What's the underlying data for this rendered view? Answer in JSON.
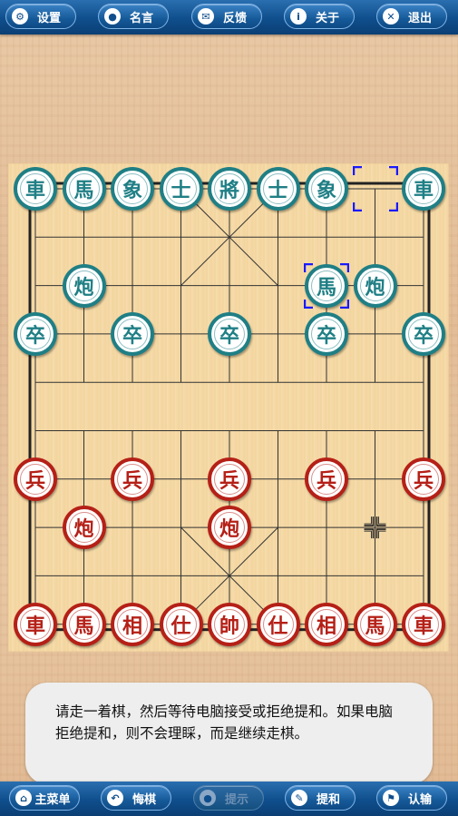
{
  "top_menu": [
    {
      "icon": "gear-icon",
      "glyph": "⚙",
      "label": "设置"
    },
    {
      "icon": "speech-bubble-icon",
      "glyph": "●",
      "label": "名言"
    },
    {
      "icon": "envelope-icon",
      "glyph": "✉",
      "label": "反馈"
    },
    {
      "icon": "info-icon",
      "glyph": "i",
      "label": "关于"
    },
    {
      "icon": "close-icon",
      "glyph": "✕",
      "label": "退出"
    }
  ],
  "bottom_menu": [
    {
      "icon": "home-icon",
      "glyph": "⌂",
      "label": "主菜单",
      "enabled": true
    },
    {
      "icon": "undo-icon",
      "glyph": "↶",
      "label": "悔棋",
      "enabled": true
    },
    {
      "icon": "hint-icon",
      "glyph": "●",
      "label": "提示",
      "enabled": false
    },
    {
      "icon": "pen-icon",
      "glyph": "✎",
      "label": "提和",
      "enabled": true
    },
    {
      "icon": "flag-icon",
      "glyph": "⚑",
      "label": "认输",
      "enabled": true
    }
  ],
  "pieces": [
    {
      "side": "black",
      "char": "車",
      "col": 0,
      "row": 0
    },
    {
      "side": "black",
      "char": "馬",
      "col": 1,
      "row": 0
    },
    {
      "side": "black",
      "char": "象",
      "col": 2,
      "row": 0
    },
    {
      "side": "black",
      "char": "士",
      "col": 3,
      "row": 0
    },
    {
      "side": "black",
      "char": "將",
      "col": 4,
      "row": 0
    },
    {
      "side": "black",
      "char": "士",
      "col": 5,
      "row": 0
    },
    {
      "side": "black",
      "char": "象",
      "col": 6,
      "row": 0
    },
    {
      "side": "black",
      "char": "車",
      "col": 8,
      "row": 0
    },
    {
      "side": "black",
      "char": "炮",
      "col": 1,
      "row": 2
    },
    {
      "side": "black",
      "char": "馬",
      "col": 6,
      "row": 2
    },
    {
      "side": "black",
      "char": "炮",
      "col": 7,
      "row": 2
    },
    {
      "side": "black",
      "char": "卒",
      "col": 0,
      "row": 3
    },
    {
      "side": "black",
      "char": "卒",
      "col": 2,
      "row": 3
    },
    {
      "side": "black",
      "char": "卒",
      "col": 4,
      "row": 3
    },
    {
      "side": "black",
      "char": "卒",
      "col": 6,
      "row": 3
    },
    {
      "side": "black",
      "char": "卒",
      "col": 8,
      "row": 3
    },
    {
      "side": "red",
      "char": "兵",
      "col": 0,
      "row": 6
    },
    {
      "side": "red",
      "char": "兵",
      "col": 2,
      "row": 6
    },
    {
      "side": "red",
      "char": "兵",
      "col": 4,
      "row": 6
    },
    {
      "side": "red",
      "char": "兵",
      "col": 6,
      "row": 6
    },
    {
      "side": "red",
      "char": "兵",
      "col": 8,
      "row": 6
    },
    {
      "side": "red",
      "char": "炮",
      "col": 1,
      "row": 7
    },
    {
      "side": "red",
      "char": "炮",
      "col": 4,
      "row": 7
    },
    {
      "side": "red",
      "char": "車",
      "col": 0,
      "row": 9
    },
    {
      "side": "red",
      "char": "馬",
      "col": 1,
      "row": 9
    },
    {
      "side": "red",
      "char": "相",
      "col": 2,
      "row": 9
    },
    {
      "side": "red",
      "char": "仕",
      "col": 3,
      "row": 9
    },
    {
      "side": "red",
      "char": "帥",
      "col": 4,
      "row": 9
    },
    {
      "side": "red",
      "char": "仕",
      "col": 5,
      "row": 9
    },
    {
      "side": "red",
      "char": "相",
      "col": 6,
      "row": 9
    },
    {
      "side": "red",
      "char": "馬",
      "col": 7,
      "row": 9
    },
    {
      "side": "red",
      "char": "車",
      "col": 8,
      "row": 9
    }
  ],
  "last_move": {
    "from": {
      "col": 7,
      "row": 0
    },
    "to": {
      "col": 6,
      "row": 2
    }
  },
  "cursor_point": {
    "col": 7,
    "row": 7
  },
  "message": "请走一着棋，然后等待电脑接受或拒绝提和。如果电脑拒绝提和，则不会理睬，而是继续走棋。",
  "colors": {
    "black_side": "#1f7f85",
    "red_side": "#b52017",
    "selection": "#1a1aff",
    "bar": "#0f4e8c"
  }
}
